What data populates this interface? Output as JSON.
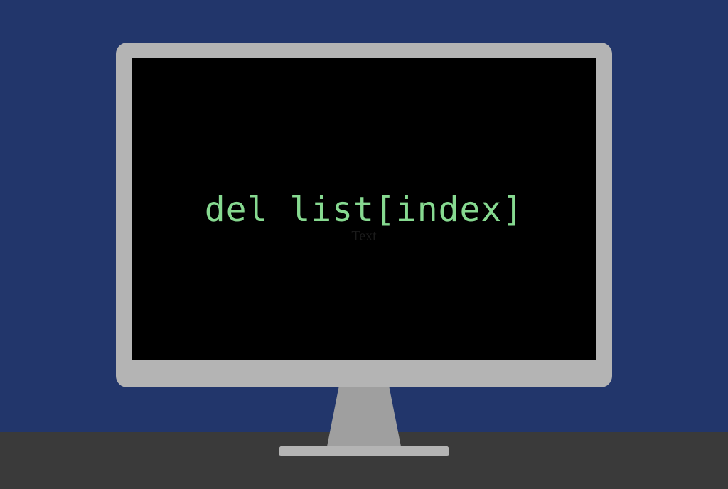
{
  "screen": {
    "code": "del list[index]",
    "ghost_label": "Text"
  },
  "colors": {
    "background": "#22366b",
    "desk": "#3a3a3a",
    "monitor_frame": "#b4b4b4",
    "monitor_neck": "#9f9f9f",
    "screen_bg": "#000000",
    "code_text": "#86d990"
  }
}
